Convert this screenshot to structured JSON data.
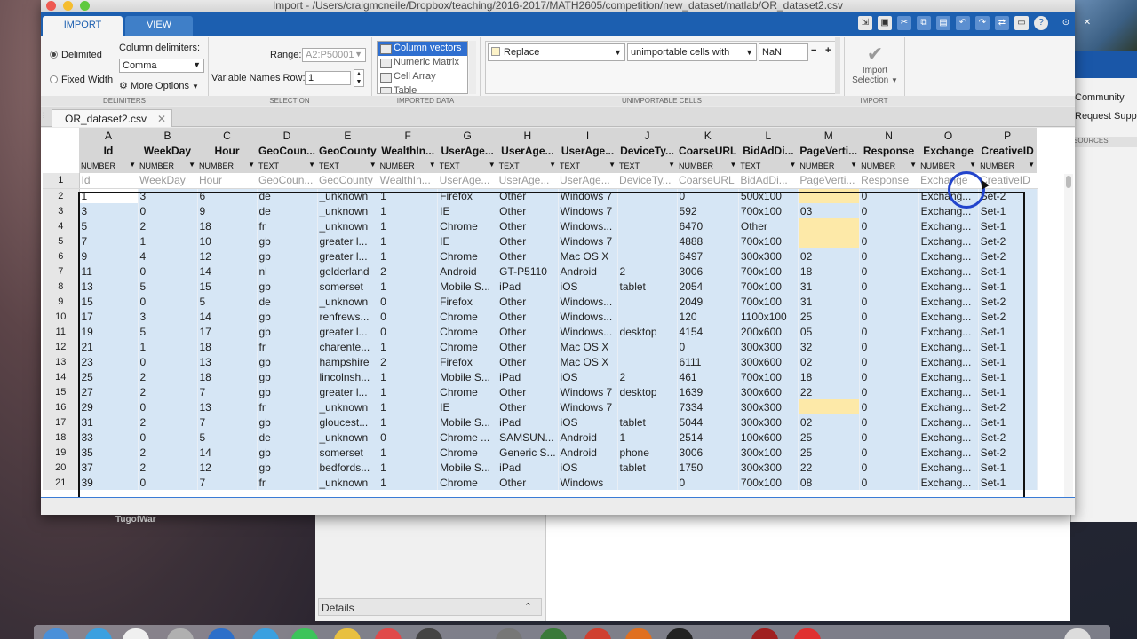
{
  "window": {
    "title": "Import - /Users/craigmcneile/Dropbox/teaching/2016-2017/MATH2605/competition/new_dataset/matlab/OR_dataset2.csv"
  },
  "ribbon_tabs": [
    "IMPORT",
    "VIEW"
  ],
  "delimiters": {
    "delimited_label": "Delimited",
    "fixed_width_label": "Fixed Width",
    "column_delimiters_label": "Column delimiters:",
    "delimiter_value": "Comma",
    "more_options_label": "More Options",
    "group_label": "DELIMITERS"
  },
  "selection": {
    "range_label": "Range:",
    "range_value": "A2:P50001",
    "var_names_row_label": "Variable Names Row:",
    "var_names_row_value": "1",
    "group_label": "SELECTION"
  },
  "imported_data": {
    "options": [
      "Column vectors",
      "Numeric Matrix",
      "Cell Array",
      "Table"
    ],
    "selected_index": 0,
    "group_label": "IMPORTED DATA"
  },
  "unimportable": {
    "rule_action": "Replace",
    "rule_condition": "unimportable cells with",
    "rule_value": "NaN",
    "minus": "−",
    "plus": "+",
    "group_label": "UNIMPORTABLE CELLS"
  },
  "import": {
    "button_label_line1": "Import",
    "button_label_line2": "Selection",
    "group_label": "IMPORT"
  },
  "doc_tab": "OR_dataset2.csv",
  "columns": {
    "letters": [
      "A",
      "B",
      "C",
      "D",
      "E",
      "F",
      "G",
      "H",
      "I",
      "J",
      "K",
      "L",
      "M",
      "N",
      "O",
      "P"
    ],
    "names": [
      "Id",
      "WeekDay",
      "Hour",
      "GeoCoun...",
      "GeoCounty",
      "WealthIn...",
      "UserAge...",
      "UserAge...",
      "UserAge...",
      "DeviceTy...",
      "CoarseURL",
      "BidAdDi...",
      "PageVerti...",
      "Response",
      "Exchange",
      "CreativeID"
    ],
    "types": [
      "NUMBER",
      "NUMBER",
      "NUMBER",
      "TEXT",
      "TEXT",
      "NUMBER",
      "TEXT",
      "TEXT",
      "TEXT",
      "TEXT",
      "NUMBER",
      "TEXT",
      "NUMBER",
      "NUMBER",
      "NUMBER",
      "NUMBER"
    ],
    "header_row": [
      "Id",
      "WeekDay",
      "Hour",
      "GeoCoun...",
      "GeoCounty",
      "WealthIn...",
      "UserAge...",
      "UserAge...",
      "UserAge...",
      "DeviceTy...",
      "CoarseURL",
      "BidAdDi...",
      "PageVerti...",
      "Response",
      "Exchange",
      "CreativeID"
    ]
  },
  "rows": [
    {
      "n": "2",
      "c": [
        "1",
        "3",
        "6",
        "de",
        "_unknown",
        "1",
        "Firefox",
        "Other",
        "Windows 7",
        "",
        "0",
        "500x100",
        "",
        "0",
        "Exchang...",
        "Set-2"
      ]
    },
    {
      "n": "3",
      "c": [
        "3",
        "0",
        "9",
        "de",
        "_unknown",
        "1",
        "IE",
        "Other",
        "Windows 7",
        "",
        "592",
        "700x100",
        "03",
        "0",
        "Exchang...",
        "Set-1"
      ]
    },
    {
      "n": "4",
      "c": [
        "5",
        "2",
        "18",
        "fr",
        "_unknown",
        "1",
        "Chrome",
        "Other",
        "Windows...",
        "",
        "6470",
        "Other",
        "",
        "0",
        "Exchang...",
        "Set-1"
      ]
    },
    {
      "n": "5",
      "c": [
        "7",
        "1",
        "10",
        "gb",
        "greater l...",
        "1",
        "IE",
        "Other",
        "Windows 7",
        "",
        "4888",
        "700x100",
        "",
        "0",
        "Exchang...",
        "Set-2"
      ]
    },
    {
      "n": "6",
      "c": [
        "9",
        "4",
        "12",
        "gb",
        "greater l...",
        "1",
        "Chrome",
        "Other",
        "Mac OS X",
        "",
        "6497",
        "300x300",
        "02",
        "0",
        "Exchang...",
        "Set-2"
      ]
    },
    {
      "n": "7",
      "c": [
        "11",
        "0",
        "14",
        "nl",
        "gelderland",
        "2",
        "Android",
        "GT-P5110",
        "Android",
        "2",
        "3006",
        "700x100",
        "18",
        "0",
        "Exchang...",
        "Set-1"
      ]
    },
    {
      "n": "8",
      "c": [
        "13",
        "5",
        "15",
        "gb",
        "somerset",
        "1",
        "Mobile S...",
        "iPad",
        "iOS",
        "tablet",
        "2054",
        "700x100",
        "31",
        "0",
        "Exchang...",
        "Set-1"
      ]
    },
    {
      "n": "9",
      "c": [
        "15",
        "0",
        "5",
        "de",
        "_unknown",
        "0",
        "Firefox",
        "Other",
        "Windows...",
        "",
        "2049",
        "700x100",
        "31",
        "0",
        "Exchang...",
        "Set-2"
      ]
    },
    {
      "n": "10",
      "c": [
        "17",
        "3",
        "14",
        "gb",
        "renfrews...",
        "0",
        "Chrome",
        "Other",
        "Windows...",
        "",
        "120",
        "1100x100",
        "25",
        "0",
        "Exchang...",
        "Set-2"
      ]
    },
    {
      "n": "11",
      "c": [
        "19",
        "5",
        "17",
        "gb",
        "greater l...",
        "0",
        "Chrome",
        "Other",
        "Windows...",
        "desktop",
        "4154",
        "200x600",
        "05",
        "0",
        "Exchang...",
        "Set-1"
      ]
    },
    {
      "n": "12",
      "c": [
        "21",
        "1",
        "18",
        "fr",
        "charente...",
        "1",
        "Chrome",
        "Other",
        "Mac OS X",
        "",
        "0",
        "300x300",
        "32",
        "0",
        "Exchang...",
        "Set-1"
      ]
    },
    {
      "n": "13",
      "c": [
        "23",
        "0",
        "13",
        "gb",
        "hampshire",
        "2",
        "Firefox",
        "Other",
        "Mac OS X",
        "",
        "6111",
        "300x600",
        "02",
        "0",
        "Exchang...",
        "Set-1"
      ]
    },
    {
      "n": "14",
      "c": [
        "25",
        "2",
        "18",
        "gb",
        "lincolnsh...",
        "1",
        "Mobile S...",
        "iPad",
        "iOS",
        "2",
        "461",
        "700x100",
        "18",
        "0",
        "Exchang...",
        "Set-1"
      ]
    },
    {
      "n": "15",
      "c": [
        "27",
        "2",
        "7",
        "gb",
        "greater l...",
        "1",
        "Chrome",
        "Other",
        "Windows 7",
        "desktop",
        "1639",
        "300x600",
        "22",
        "0",
        "Exchang...",
        "Set-1"
      ]
    },
    {
      "n": "16",
      "c": [
        "29",
        "0",
        "13",
        "fr",
        "_unknown",
        "1",
        "IE",
        "Other",
        "Windows 7",
        "",
        "7334",
        "300x300",
        "",
        "0",
        "Exchang...",
        "Set-2"
      ]
    },
    {
      "n": "17",
      "c": [
        "31",
        "2",
        "7",
        "gb",
        "gloucest...",
        "1",
        "Mobile S...",
        "iPad",
        "iOS",
        "tablet",
        "5044",
        "300x300",
        "02",
        "0",
        "Exchang...",
        "Set-1"
      ]
    },
    {
      "n": "18",
      "c": [
        "33",
        "0",
        "5",
        "de",
        "_unknown",
        "0",
        "Chrome ...",
        "SAMSUN...",
        "Android",
        "1",
        "2514",
        "100x600",
        "25",
        "0",
        "Exchang...",
        "Set-2"
      ]
    },
    {
      "n": "19",
      "c": [
        "35",
        "2",
        "14",
        "gb",
        "somerset",
        "1",
        "Chrome",
        "Generic S...",
        "Android",
        "phone",
        "3006",
        "300x100",
        "25",
        "0",
        "Exchang...",
        "Set-2"
      ]
    },
    {
      "n": "20",
      "c": [
        "37",
        "2",
        "12",
        "gb",
        "bedfords...",
        "1",
        "Mobile S...",
        "iPad",
        "iOS",
        "tablet",
        "1750",
        "300x300",
        "22",
        "0",
        "Exchang...",
        "Set-1"
      ]
    },
    {
      "n": "21",
      "c": [
        "39",
        "0",
        "7",
        "fr",
        "_unknown",
        "1",
        "Chrome",
        "Other",
        "Windows",
        "",
        "0",
        "700x100",
        "08",
        "0",
        "Exchang...",
        "Set-1"
      ]
    }
  ],
  "highlight_cells": [
    [
      0,
      12
    ],
    [
      2,
      12
    ],
    [
      3,
      12
    ],
    [
      14,
      12
    ]
  ],
  "background": {
    "community": "Community",
    "request_support": "Request Support",
    "sources": "SOURCES",
    "details": "Details",
    "desktop_folder": "TugofWar"
  },
  "colors": {
    "ribbon_blue": "#1c5fb0",
    "cell_blue": "#d6e6f5",
    "cell_highlight": "#fde9a8"
  }
}
